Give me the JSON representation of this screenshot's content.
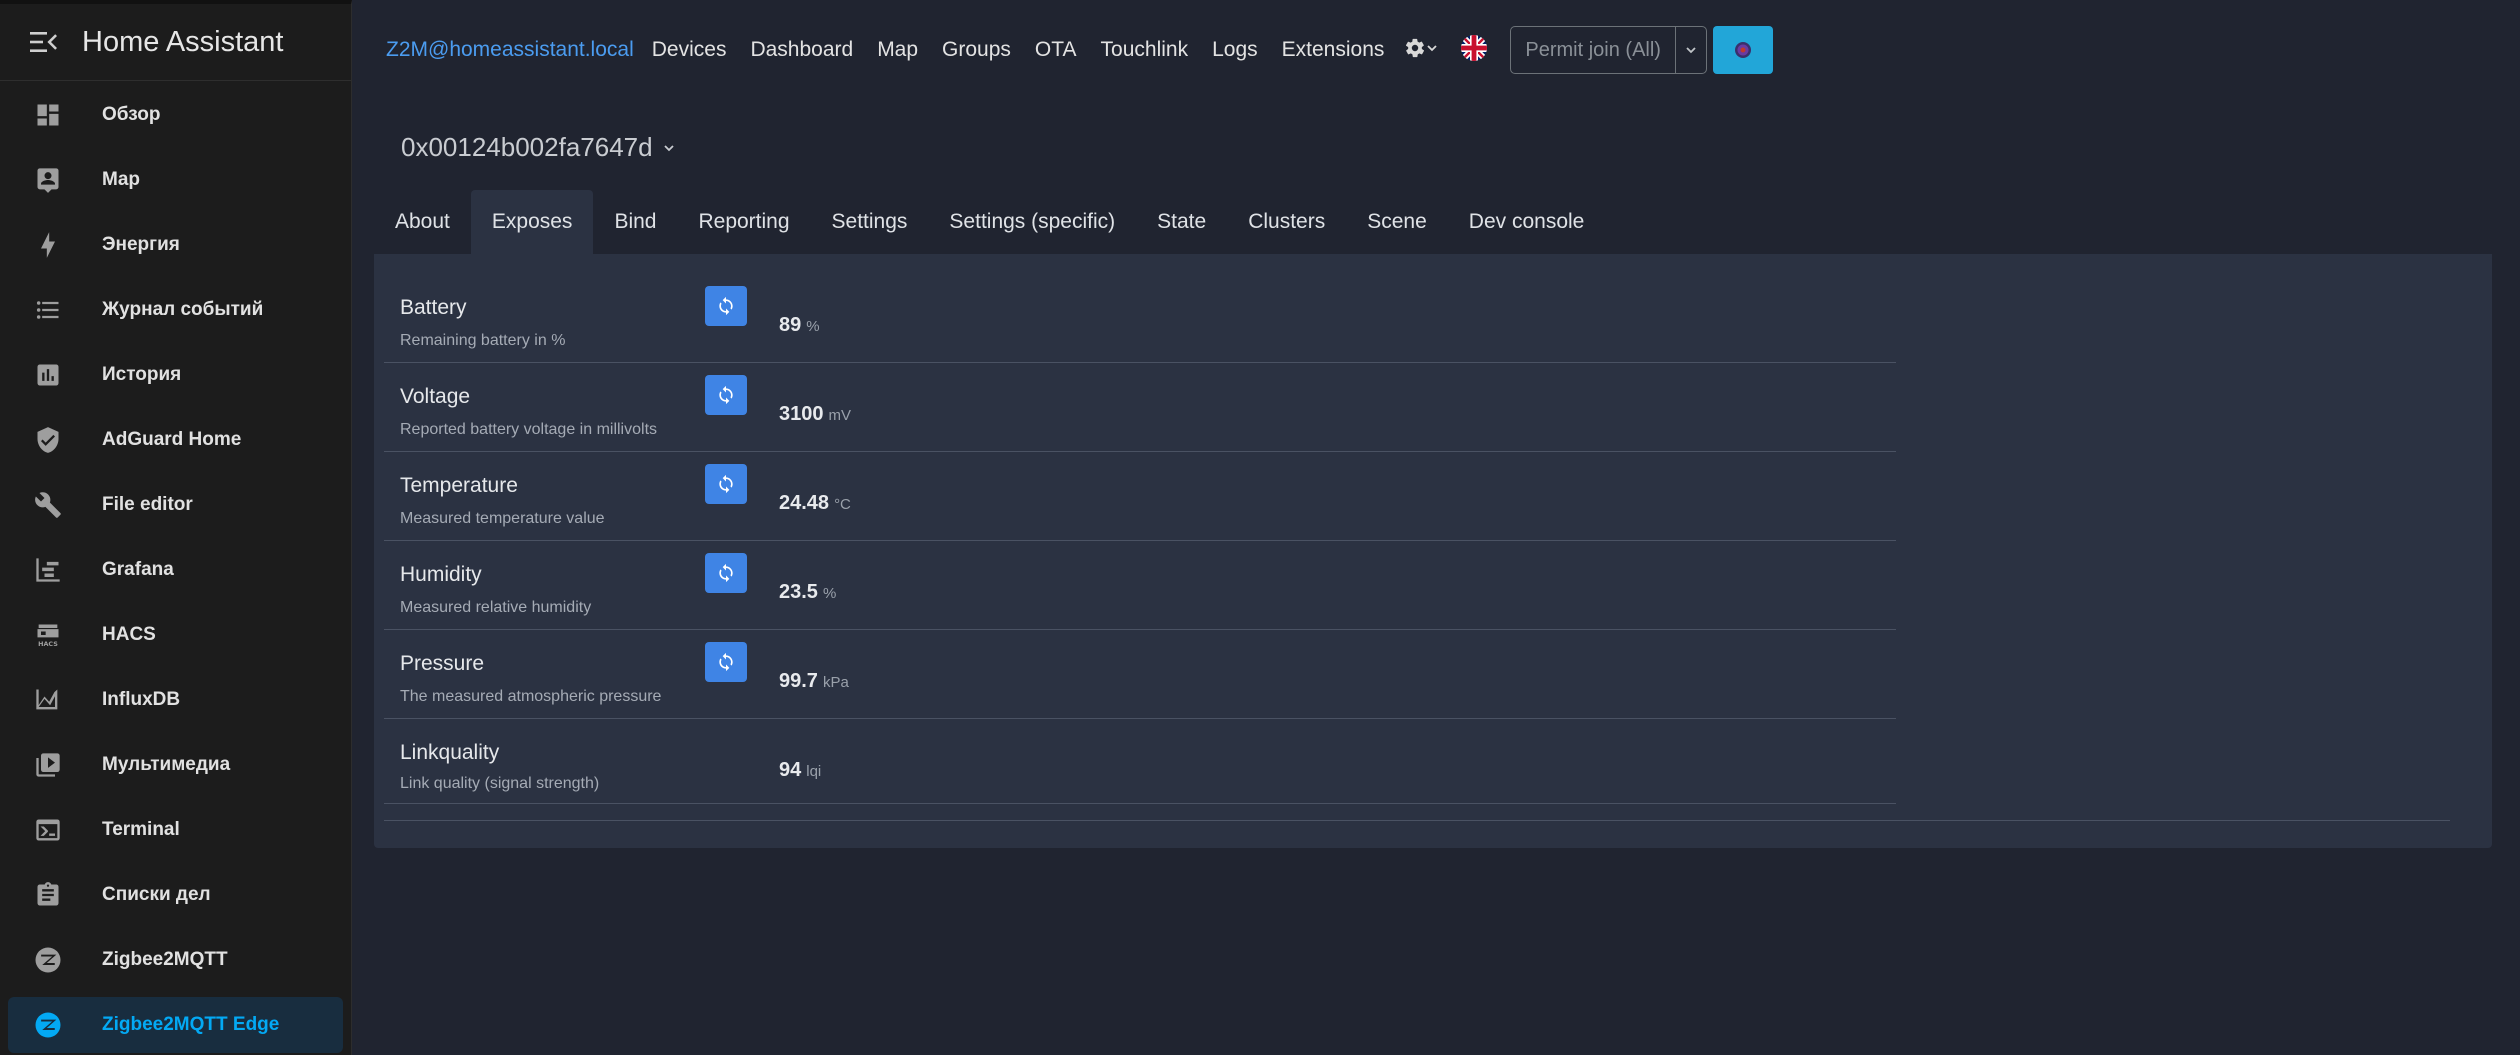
{
  "sidebar": {
    "title": "Home Assistant",
    "items": [
      {
        "label": "Обзор",
        "icon": "dashboard-icon"
      },
      {
        "label": "Map",
        "icon": "map-account-icon"
      },
      {
        "label": "Энергия",
        "icon": "lightning-bolt-icon"
      },
      {
        "label": "Журнал событий",
        "icon": "format-list-bulleted-icon"
      },
      {
        "label": "История",
        "icon": "chart-box-icon"
      },
      {
        "label": "AdGuard Home",
        "icon": "shield-check-icon"
      },
      {
        "label": "File editor",
        "icon": "wrench-icon"
      },
      {
        "label": "Grafana",
        "icon": "chart-timeline-icon"
      },
      {
        "label": "HACS",
        "icon": "hacs-store-icon"
      },
      {
        "label": "InfluxDB",
        "icon": "chart-areaspline-icon"
      },
      {
        "label": "Мультимедиа",
        "icon": "play-box-multiple-icon"
      },
      {
        "label": "Terminal",
        "icon": "console-icon"
      },
      {
        "label": "Списки дел",
        "icon": "clipboard-list-icon"
      },
      {
        "label": "Zigbee2MQTT",
        "icon": "zigbee-icon"
      },
      {
        "label": "Zigbee2MQTT Edge",
        "icon": "zigbee-icon",
        "active": true
      }
    ]
  },
  "topnav": {
    "brand": "Z2M@homeassistant.local",
    "links": [
      "Devices",
      "Dashboard",
      "Map",
      "Groups",
      "OTA",
      "Touchlink",
      "Logs",
      "Extensions"
    ],
    "permit_join_label": "Permit join (All)"
  },
  "device": {
    "title": "0x00124b002fa7647d"
  },
  "tabs": [
    "About",
    "Exposes",
    "Bind",
    "Reporting",
    "Settings",
    "Settings (specific)",
    "State",
    "Clusters",
    "Scene",
    "Dev console"
  ],
  "active_tab": "Exposes",
  "exposes": [
    {
      "name": "Battery",
      "description": "Remaining battery in %",
      "value": "89",
      "unit": "%",
      "refreshable": true
    },
    {
      "name": "Voltage",
      "description": "Reported battery voltage in millivolts",
      "value": "3100",
      "unit": "mV",
      "refreshable": true
    },
    {
      "name": "Temperature",
      "description": "Measured temperature value",
      "value": "24.48",
      "unit": "°C",
      "refreshable": true
    },
    {
      "name": "Humidity",
      "description": "Measured relative humidity",
      "value": "23.5",
      "unit": "%",
      "refreshable": true
    },
    {
      "name": "Pressure",
      "description": "The measured atmospheric pressure",
      "value": "99.7",
      "unit": "kPa",
      "refreshable": true
    },
    {
      "name": "Linkquality",
      "description": "Link quality (signal strength)",
      "value": "94",
      "unit": "lqi",
      "refreshable": false
    }
  ],
  "colors": {
    "accent": "#03a9f4",
    "brand_link": "#4b9cf0",
    "refresh_button": "#3f84e5",
    "panel": "#2b3242",
    "background": "#202430",
    "sidebar": "#1c1c1c"
  }
}
